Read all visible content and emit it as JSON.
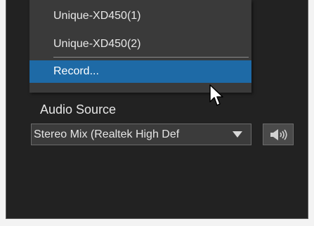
{
  "source_menu": {
    "items": [
      {
        "label": "Unique-XD450(1)"
      },
      {
        "label": "Unique-XD450(2)"
      },
      {
        "label": "Record..."
      }
    ],
    "selected_index": 2
  },
  "audio": {
    "label": "Audio Source",
    "selected": "Stereo Mix (Realtek High Def",
    "speaker_icon": "speaker-icon"
  },
  "colors": {
    "panel_bg": "#222222",
    "menu_bg": "#3a3a3a",
    "highlight": "#1e6aa6"
  }
}
